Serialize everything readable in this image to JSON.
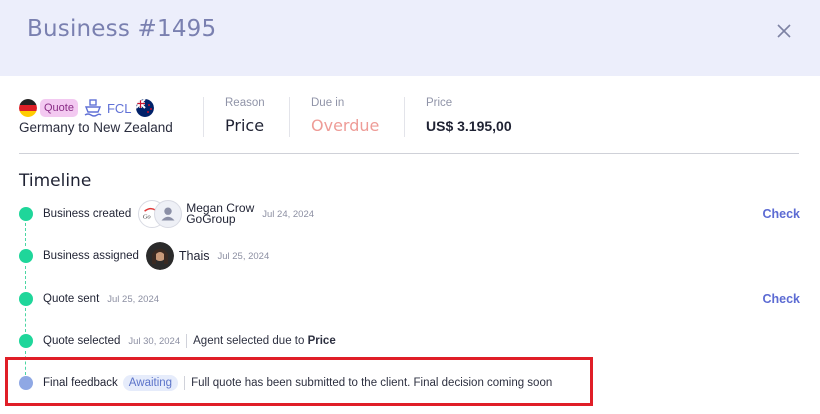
{
  "header": {
    "title": "Business #1495"
  },
  "route": {
    "origin_flag": "germany-flag-icon",
    "quote_badge": "Quote",
    "mode_icon": "ship-icon",
    "mode_label": "FCL",
    "destination_flag": "new-zealand-flag-icon",
    "text": "Germany to New Zealand"
  },
  "summary": {
    "reason_label": "Reason",
    "reason_value": "Price",
    "due_label": "Due in",
    "due_value": "Overdue",
    "price_label": "Price",
    "price_value": "US$ 3.195,00"
  },
  "timeline": {
    "title": "Timeline",
    "events": [
      {
        "label": "Business created",
        "person_name": "Megan Crow",
        "person_company": "GoGroup",
        "date": "Jul 24, 2024",
        "action": "Check",
        "status": "done"
      },
      {
        "label": "Business assigned",
        "person_name": "Thais",
        "date": "Jul 25, 2024",
        "status": "done"
      },
      {
        "label": "Quote sent",
        "date": "Jul 25, 2024",
        "action": "Check",
        "status": "done"
      },
      {
        "label": "Quote selected",
        "date": "Jul 30, 2024",
        "description_prefix": "Agent selected due to",
        "description_bold": "Price",
        "status": "done"
      },
      {
        "label": "Final feedback",
        "badge": "Awaiting",
        "description": "Full quote has been submitted to the client. Final decision coming soon",
        "status": "pending"
      }
    ]
  },
  "colors": {
    "header_bg": "#eceefb",
    "accent": "#5c6bd3",
    "done": "#1fd69a",
    "pending": "#8fa8e4",
    "overdue": "#ee9c97",
    "highlight": "#e01e27"
  }
}
